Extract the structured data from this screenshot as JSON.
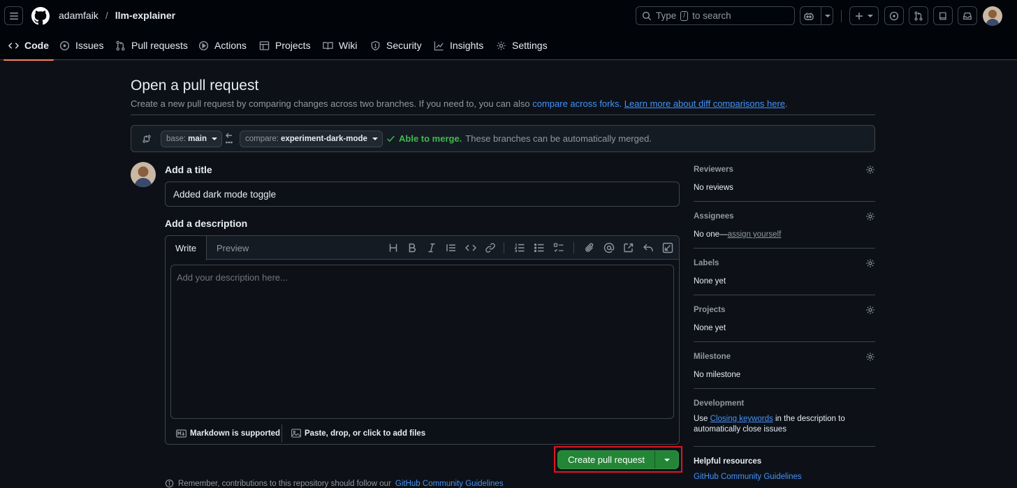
{
  "header": {
    "owner": "adamfaik",
    "separator": "/",
    "repo": "llm-explainer",
    "search_prefix": "Type",
    "search_kbd": "/",
    "search_suffix": "to search"
  },
  "nav": {
    "tabs": [
      {
        "label": "Code",
        "icon": "code-icon"
      },
      {
        "label": "Issues",
        "icon": "issue-icon"
      },
      {
        "label": "Pull requests",
        "icon": "pull-request-icon"
      },
      {
        "label": "Actions",
        "icon": "play-icon"
      },
      {
        "label": "Projects",
        "icon": "table-icon"
      },
      {
        "label": "Wiki",
        "icon": "book-icon"
      },
      {
        "label": "Security",
        "icon": "shield-icon"
      },
      {
        "label": "Insights",
        "icon": "graph-icon"
      },
      {
        "label": "Settings",
        "icon": "gear-icon"
      }
    ],
    "active_tab": "Code"
  },
  "page": {
    "title": "Open a pull request",
    "subtitle_text": "Create a new pull request by comparing changes across two branches. If you need to, you can also",
    "compare_forks_link": "compare across forks.",
    "learn_more_link": "Learn more about diff comparisons here",
    "subtitle_end": "."
  },
  "compare": {
    "base_prefix": "base:",
    "base_branch": "main",
    "compare_prefix": "compare:",
    "compare_branch": "experiment-dark-mode",
    "merge_ok": "Able to merge.",
    "merge_detail": "These branches can be automatically merged."
  },
  "form": {
    "title_label": "Add a title",
    "title_value": "Added dark mode toggle",
    "description_label": "Add a description",
    "tab_write": "Write",
    "tab_preview": "Preview",
    "description_placeholder": "Add your description here...",
    "markdown_note": "Markdown is supported",
    "attach_note": "Paste, drop, or click to add files",
    "create_button": "Create pull request",
    "remember_text": "Remember, contributions to this repository should follow our",
    "remember_link": "GitHub Community Guidelines"
  },
  "sidebar": {
    "reviewers": {
      "title": "Reviewers",
      "value": "No reviews"
    },
    "assignees": {
      "title": "Assignees",
      "value": "No one—",
      "link": "assign yourself"
    },
    "labels": {
      "title": "Labels",
      "value": "None yet"
    },
    "projects": {
      "title": "Projects",
      "value": "None yet"
    },
    "milestone": {
      "title": "Milestone",
      "value": "No milestone"
    },
    "development": {
      "title": "Development",
      "prefix": "Use",
      "link": "Closing keywords",
      "suffix": "in the description to automatically close issues"
    },
    "help": {
      "title": "Helpful resources",
      "link": "GitHub Community Guidelines"
    }
  },
  "colors": {
    "background": "#0d1117",
    "header": "#010409",
    "accent_link": "#4493f8",
    "success": "#3fb950",
    "primary_button": "#238636",
    "active_tab_underline": "#f78166",
    "highlight_box": "#e0161e"
  }
}
